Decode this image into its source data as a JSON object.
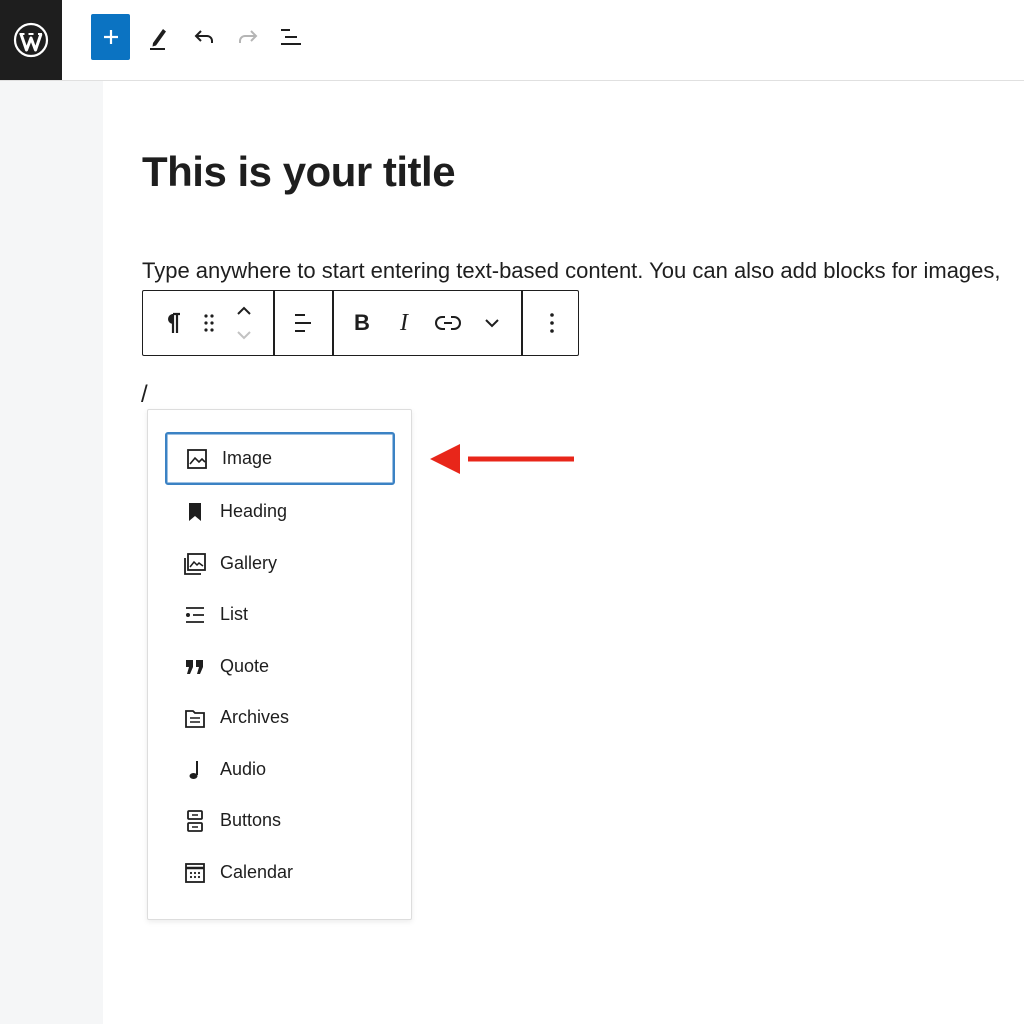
{
  "topbar": {
    "logo_icon": "wordpress-logo",
    "buttons": [
      {
        "icon": "plus-icon"
      },
      {
        "icon": "pen-icon"
      },
      {
        "icon": "undo-icon"
      },
      {
        "icon": "redo-icon"
      },
      {
        "icon": "list-view-icon"
      }
    ],
    "accent_color": "#0b73c2"
  },
  "editor": {
    "title": "This is your title",
    "paragraph": "Type anywhere to start entering text-based content. You can also add blocks for images,",
    "slash_text": "/"
  },
  "block_toolbar": {
    "items": [
      "paragraph-icon",
      "drag-handle-icon",
      "move-up-down-icon",
      "align-icon",
      "bold-icon",
      "italic-icon",
      "link-icon",
      "chevron-down-icon",
      "more-options-icon"
    ]
  },
  "inserter": {
    "items": [
      {
        "label": "Image",
        "icon": "image-icon",
        "selected": true
      },
      {
        "label": "Heading",
        "icon": "bookmark-icon"
      },
      {
        "label": "Gallery",
        "icon": "gallery-icon"
      },
      {
        "label": "List",
        "icon": "list-icon"
      },
      {
        "label": "Quote",
        "icon": "quote-icon"
      },
      {
        "label": "Archives",
        "icon": "archive-icon"
      },
      {
        "label": "Audio",
        "icon": "music-note-icon"
      },
      {
        "label": "Buttons",
        "icon": "buttons-icon"
      },
      {
        "label": "Calendar",
        "icon": "calendar-icon"
      }
    ],
    "selected_border_color": "#3b82c4"
  },
  "annotation": {
    "arrow_color": "#e8261a"
  }
}
